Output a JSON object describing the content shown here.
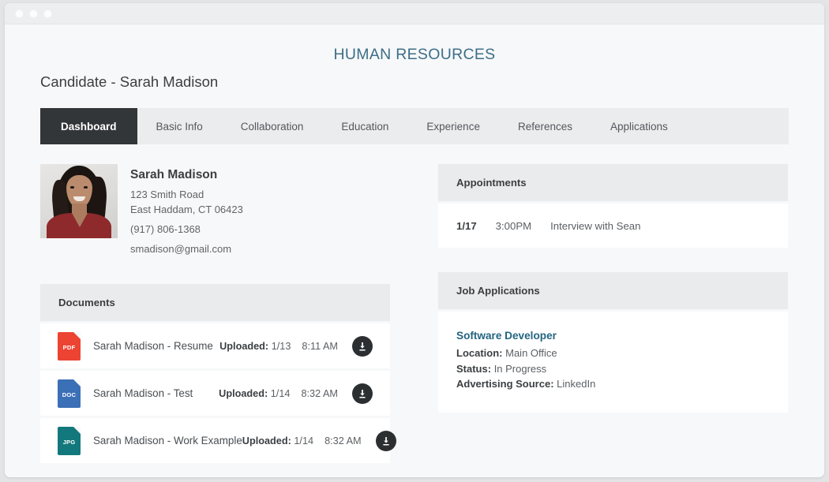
{
  "window": {
    "dots": [
      "close-dot",
      "minimize-dot",
      "maximize-dot"
    ]
  },
  "header": {
    "app_title": "HUMAN RESOURCES",
    "page_title": "Candidate - Sarah Madison",
    "accent_color": "#3d6e88"
  },
  "tabs": [
    {
      "label": "Dashboard",
      "active": true
    },
    {
      "label": "Basic Info",
      "active": false
    },
    {
      "label": "Collaboration",
      "active": false
    },
    {
      "label": "Education",
      "active": false
    },
    {
      "label": "Experience",
      "active": false
    },
    {
      "label": "References",
      "active": false
    },
    {
      "label": "Applications",
      "active": false
    }
  ],
  "profile": {
    "name": "Sarah Madison",
    "address_line1": "123 Smith Road",
    "address_line2": "East Haddam, CT 06423",
    "phone": "(917) 806-1368",
    "email": "smadison@gmail.com",
    "photo_alt": "candidate-portrait"
  },
  "documents": {
    "title": "Documents",
    "uploaded_label": "Uploaded:",
    "rows": [
      {
        "ext": "PDF",
        "icon_color": "#ec4333",
        "name": "Sarah Madison - Resume",
        "date": "1/13",
        "time": "8:11 AM",
        "action": "download-button"
      },
      {
        "ext": "DOC",
        "icon_color": "#3b6fb6",
        "name": "Sarah Madison - Test",
        "date": "1/14",
        "time": "8:32 AM",
        "action": "download-button"
      },
      {
        "ext": "JPG",
        "icon_color": "#12787c",
        "name": "Sarah Madison - Work Example",
        "date": "1/14",
        "time": "8:32 AM",
        "action": "download-button"
      }
    ]
  },
  "appointments": {
    "title": "Appointments",
    "rows": [
      {
        "date": "1/17",
        "time": "3:00PM",
        "description": "Interview with Sean"
      }
    ]
  },
  "job_applications": {
    "title": "Job Applications",
    "entries": [
      {
        "position": "Software Developer",
        "position_color": "#236580",
        "location_label": "Location:",
        "location_value": "Main Office",
        "status_label": "Status:",
        "status_value": "In Progress",
        "source_label": "Advertising Source:",
        "source_value": "LinkedIn"
      }
    ]
  }
}
